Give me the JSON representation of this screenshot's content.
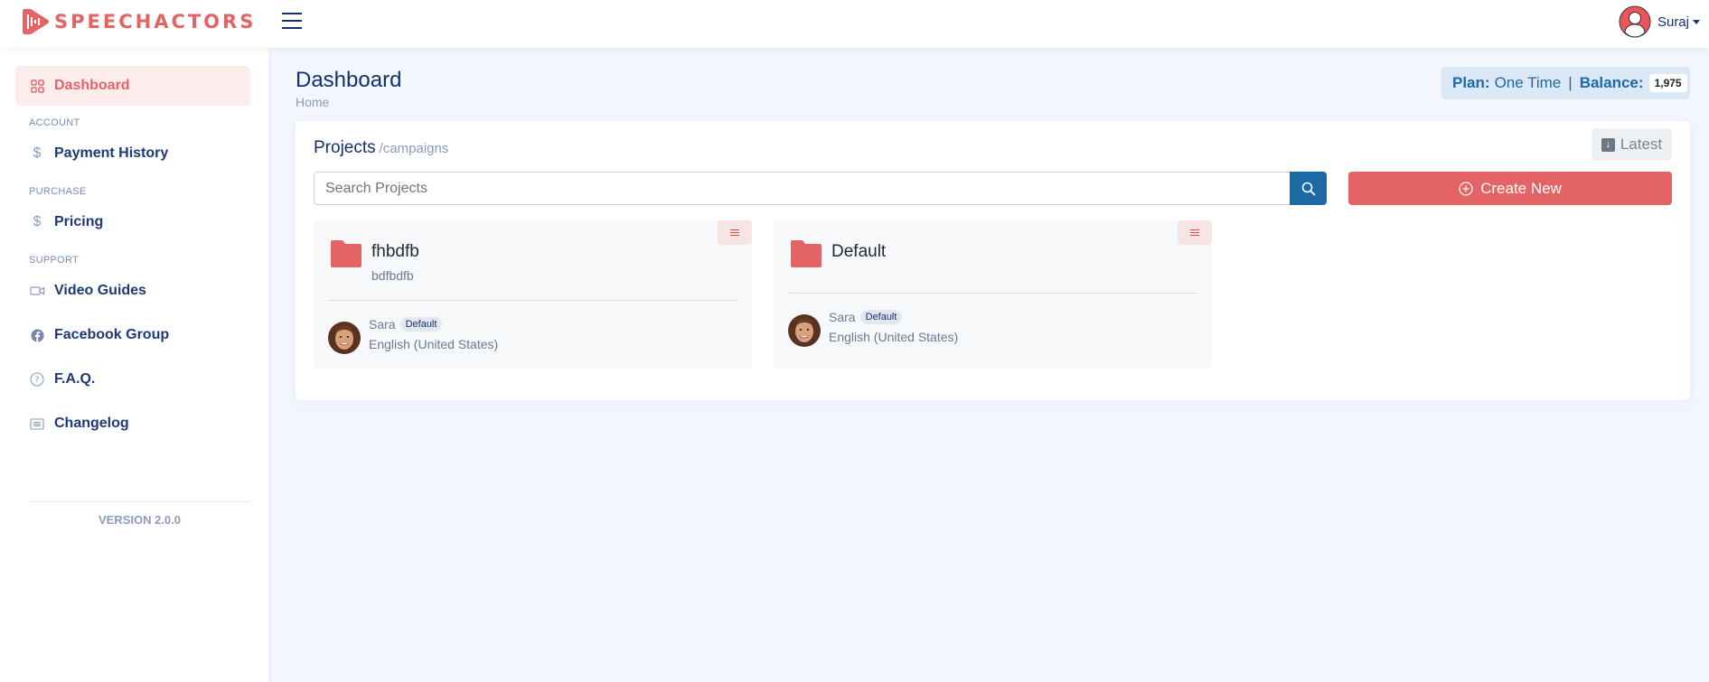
{
  "app": {
    "brand": "SPEECHACTORS",
    "brand_color": "#e46466",
    "accent_color": "#1b6aa6"
  },
  "header": {
    "user_name": "Suraj"
  },
  "sidebar": {
    "items": [
      {
        "label": "Dashboard",
        "icon": "grid-icon",
        "active": true
      },
      {
        "section": "ACCOUNT"
      },
      {
        "label": "Payment History",
        "icon": "dollar-icon"
      },
      {
        "section": "PURCHASE"
      },
      {
        "label": "Pricing",
        "icon": "dollar-icon"
      },
      {
        "section": "SUPPORT"
      },
      {
        "label": "Video Guides",
        "icon": "video-icon"
      },
      {
        "label": "Facebook Group",
        "icon": "facebook-icon"
      },
      {
        "label": "F.A.Q.",
        "icon": "question-icon"
      },
      {
        "label": "Changelog",
        "icon": "list-icon"
      }
    ],
    "version": "VERSION 2.0.0"
  },
  "page": {
    "title": "Dashboard",
    "breadcrumb": "Home",
    "plan_label": "Plan:",
    "plan_value": "One Time",
    "separator": "|",
    "balance_label": "Balance:",
    "balance_value": "1,975"
  },
  "projects": {
    "title": "Projects",
    "subtitle": "/campaigns",
    "sort_label": "Latest",
    "search_placeholder": "Search Projects",
    "search_value": "",
    "create_label": "Create New",
    "cards": [
      {
        "name": "fhbdfb",
        "description": "bdfbdfb",
        "voice": {
          "name": "Sara",
          "badge": "Default",
          "language": "English (United States)"
        }
      },
      {
        "name": "Default",
        "description": "",
        "voice": {
          "name": "Sara",
          "badge": "Default",
          "language": "English (United States)"
        }
      }
    ]
  }
}
